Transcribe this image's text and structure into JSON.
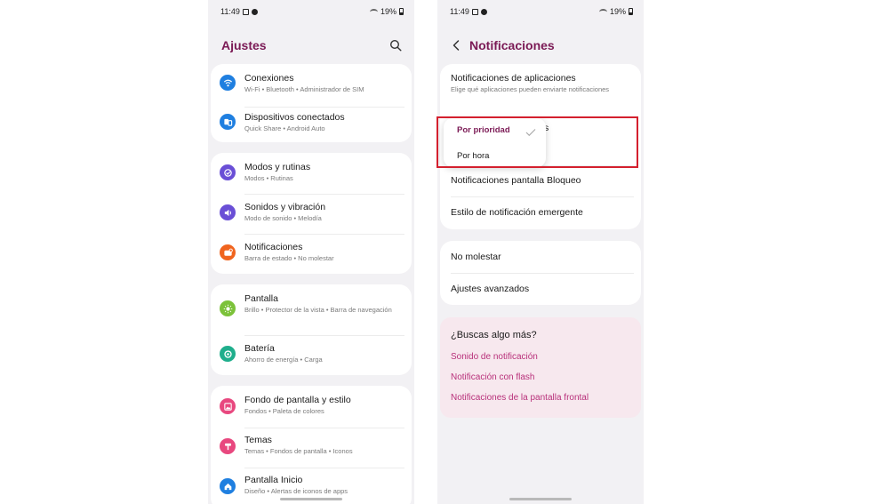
{
  "left": {
    "status": {
      "time": "11:49",
      "battery": "19%"
    },
    "title": "Ajustes",
    "groups": [
      [
        {
          "title": "Conexiones",
          "sub": "Wi-Fi  •  Bluetooth  •  Administrador de SIM",
          "icon": "wifi-icon",
          "color": "#1f7fe0"
        },
        {
          "title": "Dispositivos conectados",
          "sub": "Quick Share  •  Android Auto",
          "icon": "devices-icon",
          "color": "#1f7fe0"
        }
      ],
      [
        {
          "title": "Modos y rutinas",
          "sub": "Modos  •  Rutinas",
          "icon": "modes-icon",
          "color": "#6a4fd6"
        },
        {
          "title": "Sonidos y vibración",
          "sub": "Modo de sonido  •  Melodía",
          "icon": "sound-icon",
          "color": "#6a4fd6"
        },
        {
          "title": "Notificaciones",
          "sub": "Barra de estado  •  No molestar",
          "icon": "notifications-icon",
          "color": "#f0641e"
        }
      ],
      [
        {
          "title": "Pantalla",
          "sub": "Brillo  •  Protector de la vista  •  Barra de navegación",
          "icon": "display-icon",
          "color": "#7cc23a"
        },
        {
          "title": "Batería",
          "sub": "Ahorro de energía  •  Carga",
          "icon": "battery-icon",
          "color": "#1fae8c"
        }
      ],
      [
        {
          "title": "Fondo de pantalla y estilo",
          "sub": "Fondos  •  Paleta de colores",
          "icon": "wallpaper-icon",
          "color": "#e8487f"
        },
        {
          "title": "Temas",
          "sub": "Temas  •  Fondos de pantalla  •  Iconos",
          "icon": "themes-icon",
          "color": "#e8487f"
        },
        {
          "title": "Pantalla Inicio",
          "sub": "Diseño  •  Alertas de iconos de apps",
          "icon": "home-icon",
          "color": "#1f7fe0"
        }
      ]
    ]
  },
  "right": {
    "status": {
      "time": "11:49",
      "battery": "19%"
    },
    "title": "Notificaciones",
    "app_notifications": {
      "title": "Notificaciones de aplicaciones",
      "sub": "Elige qué aplicaciones pueden enviarte notificaciones"
    },
    "popup": {
      "option1": "Por prioridad",
      "option2": "Por hora",
      "suffix": "s"
    },
    "items": [
      "Notificaciones pantalla Bloqueo",
      "Estilo de notificación emergente",
      "No molestar",
      "Ajustes avanzados"
    ],
    "more": {
      "title": "¿Buscas algo más?",
      "links": [
        "Sonido de notificación",
        "Notificación con flash",
        "Notificaciones de la pantalla frontal"
      ]
    }
  },
  "colors": {
    "accent": "#7b1a55",
    "link": "#b8307a",
    "highlight": "#d4202e"
  }
}
